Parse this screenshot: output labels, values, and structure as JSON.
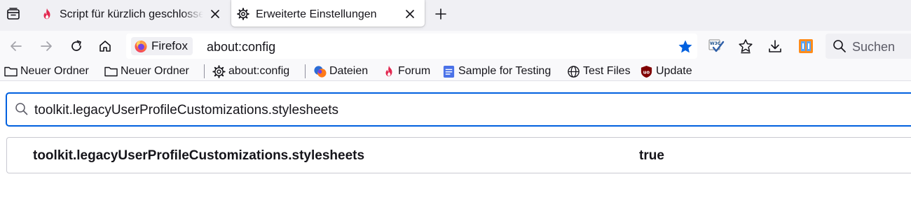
{
  "tabs": [
    {
      "title": "Script für kürzlich geschlossene Tabs",
      "icon": "flame-icon",
      "active": false
    },
    {
      "title": "Erweiterte Einstellungen",
      "icon": "gear-icon",
      "active": true
    }
  ],
  "navbar": {
    "identity_label": "Firefox",
    "url": "about:config",
    "search_placeholder": "Suchen",
    "bookmarked": true
  },
  "bookmarks": [
    {
      "label": "Neuer Ordner",
      "icon": "folder-icon"
    },
    {
      "label": "Neuer Ordner",
      "icon": "folder-icon"
    },
    {
      "label": "about:config",
      "icon": "gear-icon"
    },
    {
      "label": "Dateien",
      "icon": "files-icon"
    },
    {
      "label": "Forum",
      "icon": "flame-icon"
    },
    {
      "label": "Sample for Testing",
      "icon": "document-icon"
    },
    {
      "label": "Test Files",
      "icon": "globe-icon"
    },
    {
      "label": "Update",
      "icon": "ublock-icon"
    }
  ],
  "config": {
    "search_value": "toolkit.legacyUserProfileCustomizations.stylesheets",
    "pref_name": "toolkit.legacyUserProfileCustomizations.stylesheets",
    "pref_value": "true"
  },
  "colors": {
    "accent": "#0060df",
    "flame": "#e22850",
    "star": "#0060df"
  }
}
